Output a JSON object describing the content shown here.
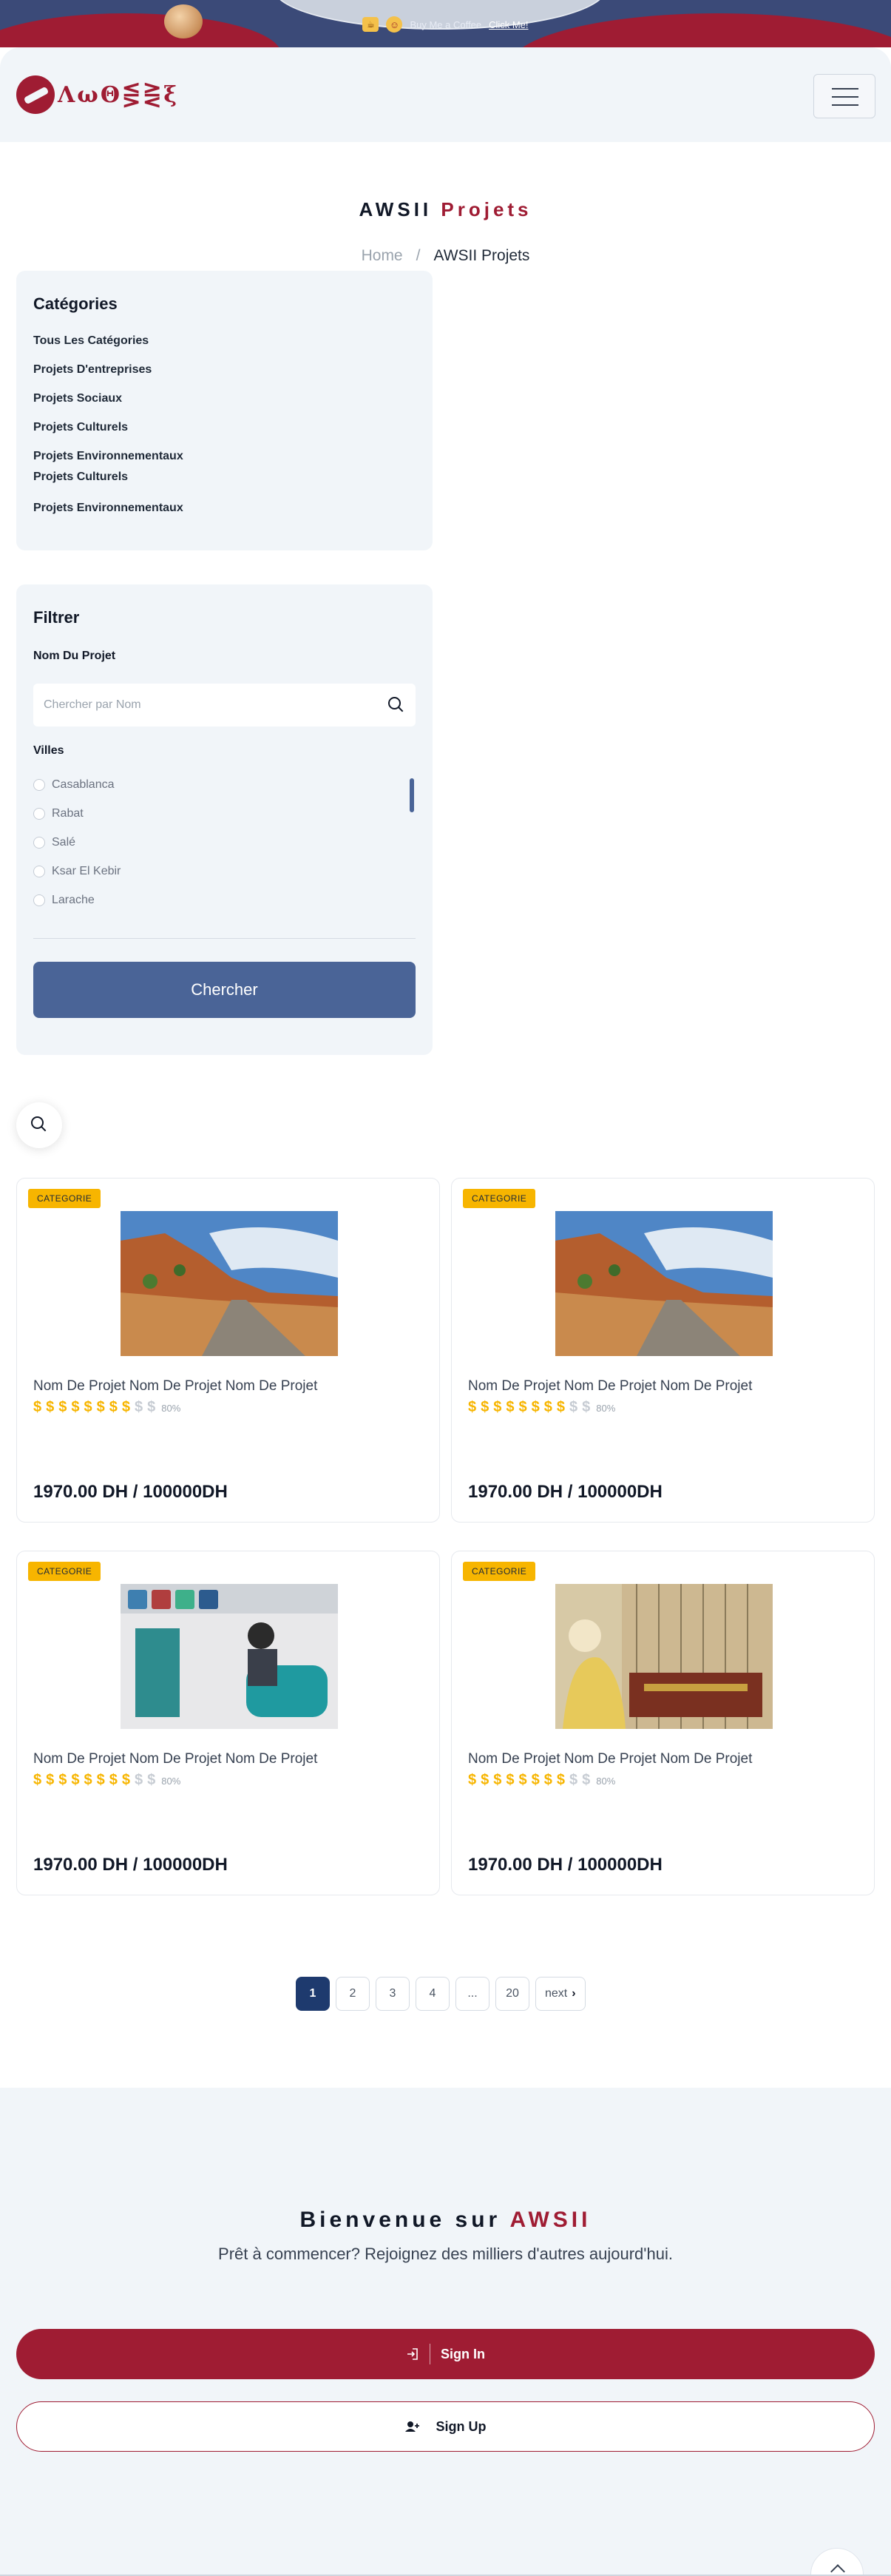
{
  "promo": {
    "text": "Buy Me a Coffee",
    "link": "Click Me!"
  },
  "header": {
    "logo_text": "ΛωΘ⋚⋛ξ"
  },
  "page": {
    "title_main": "AWSII",
    "title_accent": "Projets",
    "breadcrumb_home": "Home",
    "breadcrumb_sep": "/",
    "breadcrumb_current": "AWSII Projets"
  },
  "categories": {
    "title": "Catégories",
    "items": [
      "Tous Les Catégories",
      "Projets D'entreprises",
      "Projets Sociaux",
      "Projets Culturels",
      "Projets Environnementaux",
      "Projets Culturels",
      "Projets Environnementaux"
    ]
  },
  "filter": {
    "title": "Filtrer",
    "name_label": "Nom Du Projet",
    "search_placeholder": "Chercher par Nom",
    "cities_label": "Villes",
    "cities": [
      "Casablanca",
      "Rabat",
      "Salé",
      "Ksar El Kebir",
      "Larache"
    ],
    "submit_label": "Chercher"
  },
  "products": [
    {
      "category": "CATEGORIE",
      "name": "Nom De Projet Nom De Projet Nom De Projet",
      "rating_percent": "80%",
      "price": "1970.00 DH / 100000DH",
      "image": "landscape-road"
    },
    {
      "category": "CATEGORIE",
      "name": "Nom De Projet Nom De Projet Nom De Projet",
      "rating_percent": "80%",
      "price": "1970.00 DH / 100000DH",
      "image": "landscape-road"
    },
    {
      "category": "CATEGORIE",
      "name": "Nom De Projet Nom De Projet Nom De Projet",
      "rating_percent": "80%",
      "price": "1970.00 DH / 100000DH",
      "image": "pottery-artisan"
    },
    {
      "category": "CATEGORIE",
      "name": "Nom De Projet Nom De Projet Nom De Projet",
      "rating_percent": "80%",
      "price": "1970.00 DH / 100000DH",
      "image": "carpet-weaver"
    }
  ],
  "rating": {
    "filled": 8,
    "total": 10,
    "symbol": "$"
  },
  "pagination": {
    "pages": [
      "1",
      "2",
      "3",
      "4",
      "...",
      "20"
    ],
    "active": "1",
    "next_label": "next"
  },
  "welcome": {
    "title_main": "Bienvenue sur",
    "title_accent": "AWSII",
    "subtitle": "Prêt à commencer? Rejoignez des milliers d'autres aujourd'hui.",
    "signin_label": "Sign In",
    "signup_label": "Sign Up"
  },
  "colors": {
    "brand": "#9f1c33",
    "primary_button": "#4a6497",
    "badge": "#f7b500",
    "page_active": "#1e3a6e"
  }
}
